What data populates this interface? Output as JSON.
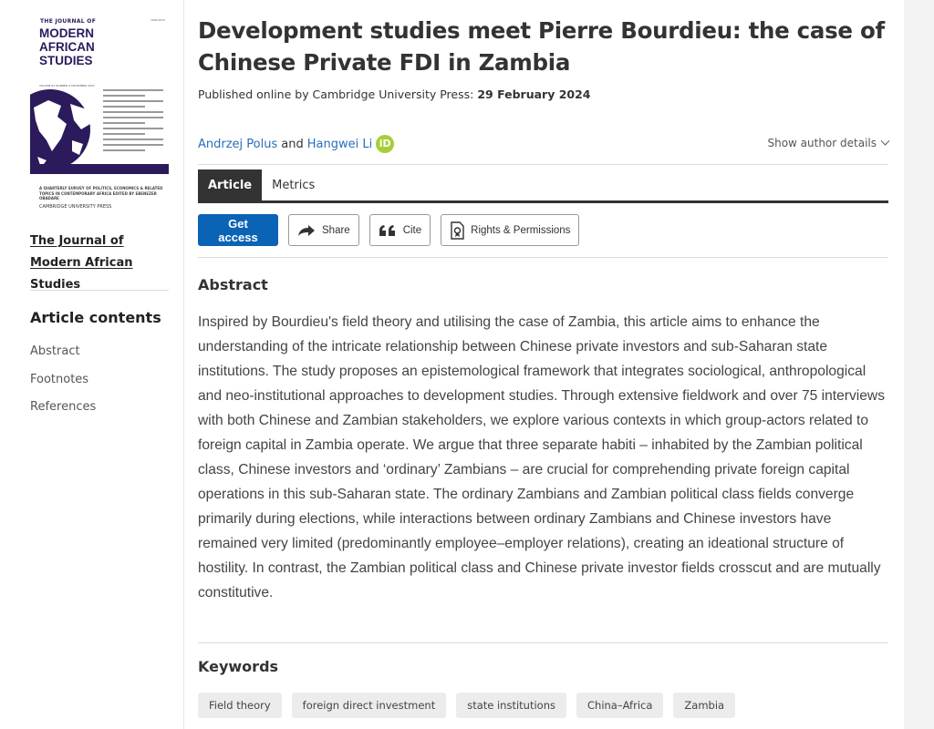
{
  "sidebar": {
    "cover": {
      "journal_small": "THE JOURNAL OF",
      "journal_big_1": "MODERN",
      "journal_big_2": "AFRICAN",
      "journal_big_3": "STUDIES",
      "volume": "VOLUME 61 NUMBER 4 DECEMBER 2023",
      "isbn": "ISSN 0022",
      "description": "A QUARTERLY SURVEY OF POLITICS, ECONOMICS & RELATED TOPICS IN CONTEMPORARY AFRICA EDITED BY EBENEZER OBADARE",
      "press": "CAMBRIDGE UNIVERSITY PRESS"
    },
    "journal_link": "The Journal of Modern African Studies",
    "contents_title": "Article contents",
    "contents_items": [
      "Abstract",
      "Footnotes",
      "References"
    ]
  },
  "article": {
    "title": "Development studies meet Pierre Bourdieu: the case of Chinese Private FDI in Zambia",
    "published_label": "Published online by Cambridge University Press:",
    "published_date": "29 February 2024",
    "authors": [
      "Andrzej Polus",
      "Hangwei Li"
    ],
    "and_label": "and",
    "orcid_label": "iD",
    "show_details": "Show author details"
  },
  "tabs": [
    "Article",
    "Metrics"
  ],
  "actions": {
    "get_access": "Get access",
    "share": "Share",
    "cite": "Cite",
    "rights": "Rights & Permissions"
  },
  "abstract": {
    "heading": "Abstract",
    "text": "Inspired by Bourdieu's field theory and utilising the case of Zambia, this article aims to enhance the understanding of the intricate relationship between Chinese private investors and sub-Saharan state institutions. The study proposes an epistemological framework that integrates sociological, anthropological and neo-institutional approaches to development studies. Through extensive fieldwork and over 75 interviews with both Chinese and Zambian stakeholders, we explore various contexts in which group-actors related to foreign capital in Zambia operate. We argue that three separate habiti – inhabited by the Zambian political class, Chinese investors and ‘ordinary’ Zambians – are crucial for comprehending private foreign capital operations in this sub-Saharan state. The ordinary Zambians and Zambian political class fields converge primarily during elections, while interactions between ordinary Zambians and Chinese investors have remained very limited (predominantly employee–employer relations), creating an ideational structure of hostility. In contrast, the Zambian political class and Chinese private investor fields crosscut and are mutually constitutive."
  },
  "keywords": {
    "heading": "Keywords",
    "items": [
      "Field theory",
      "foreign direct investment",
      "state institutions",
      "China–Africa",
      "Zambia"
    ]
  },
  "colors": {
    "accent": "#0b63b6",
    "link": "#2a6ebb",
    "cover_purple": "#2b1a5c",
    "orcid": "#a6ce39"
  }
}
